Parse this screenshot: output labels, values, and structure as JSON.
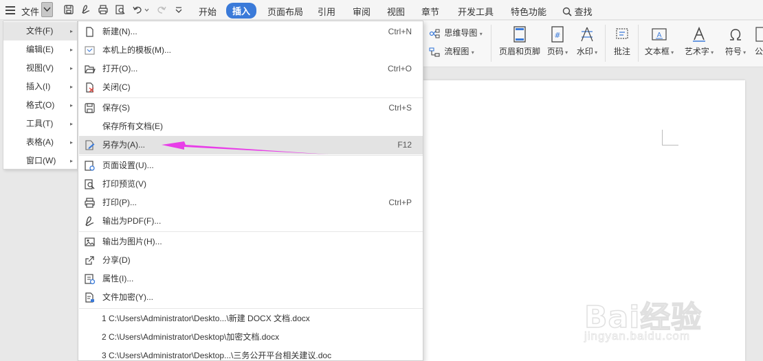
{
  "menubar": {
    "file_label": "文件",
    "tabs": [
      "开始",
      "插入",
      "页面布局",
      "引用",
      "审阅",
      "视图",
      "章节",
      "开发工具",
      "特色功能"
    ],
    "active_tab": "插入",
    "search_label": "查找"
  },
  "ribbon": {
    "mindmap": "思维导图",
    "flowchart": "流程图",
    "header_footer": "页眉和页脚",
    "page_number": "页码",
    "watermark": "水印",
    "comment": "批注",
    "textbox": "文本框",
    "wordart": "艺术字",
    "symbol": "符号",
    "formula_cut": "公"
  },
  "left_menu": {
    "items": [
      {
        "label": "文件(F)"
      },
      {
        "label": "编辑(E)"
      },
      {
        "label": "视图(V)"
      },
      {
        "label": "插入(I)"
      },
      {
        "label": "格式(O)"
      },
      {
        "label": "工具(T)"
      },
      {
        "label": "表格(A)"
      },
      {
        "label": "窗口(W)"
      }
    ]
  },
  "file_menu": {
    "items": [
      {
        "label": "新建(N)...",
        "shortcut": "Ctrl+N",
        "icon": "new-doc-icon"
      },
      {
        "label": "本机上的模板(M)...",
        "shortcut": "",
        "icon": "template-icon"
      },
      {
        "label": "打开(O)...",
        "shortcut": "Ctrl+O",
        "icon": "folder-open-icon"
      },
      {
        "label": "关闭(C)",
        "shortcut": "",
        "icon": "close-doc-icon"
      },
      {
        "label": "保存(S)",
        "shortcut": "Ctrl+S",
        "icon": "save-icon"
      },
      {
        "label": "保存所有文档(E)",
        "shortcut": "",
        "icon": ""
      },
      {
        "label": "另存为(A)...",
        "shortcut": "F12",
        "icon": "save-as-icon"
      },
      {
        "label": "页面设置(U)...",
        "shortcut": "",
        "icon": "page-setup-icon"
      },
      {
        "label": "打印预览(V)",
        "shortcut": "",
        "icon": "print-preview-icon"
      },
      {
        "label": "打印(P)...",
        "shortcut": "Ctrl+P",
        "icon": "printer-icon"
      },
      {
        "label": "输出为PDF(F)...",
        "shortcut": "",
        "icon": "pdf-export-icon"
      },
      {
        "label": "输出为图片(H)...",
        "shortcut": "",
        "icon": "image-export-icon"
      },
      {
        "label": "分享(D)",
        "shortcut": "",
        "icon": "share-icon"
      },
      {
        "label": "属性(I)...",
        "shortcut": "",
        "icon": "properties-icon"
      },
      {
        "label": "文件加密(Y)...",
        "shortcut": "",
        "icon": "encrypt-icon"
      }
    ],
    "recent": [
      "1 C:\\Users\\Administrator\\Deskto...\\新建 DOCX 文档.docx",
      "2 C:\\Users\\Administrator\\Desktop\\加密文档.docx",
      "3 C:\\Users\\Administrator\\Desktop...\\三务公开平台相关建议.doc"
    ]
  },
  "watermark": {
    "brand": "Bai经验",
    "url": "jingyan.baidu.com"
  },
  "colors": {
    "accent": "#3a7ad9",
    "annotation_arrow": "#e83ee8",
    "hover": "#e3e3e3"
  }
}
